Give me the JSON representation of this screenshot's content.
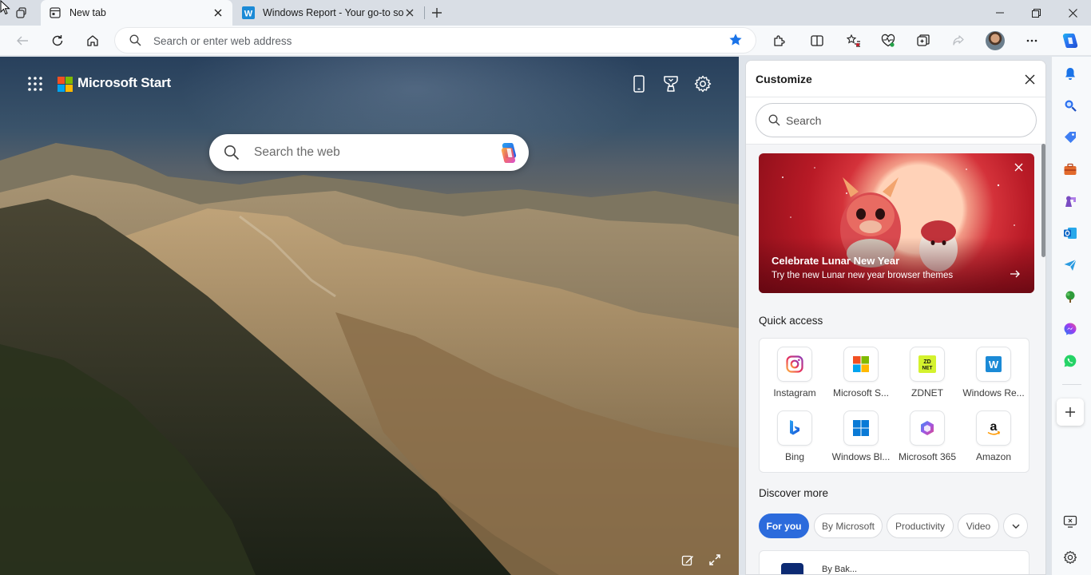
{
  "tabs": [
    {
      "title": "New tab",
      "active": true,
      "icon": "newtab-page-icon"
    },
    {
      "title": "Windows Report - Your go-to source",
      "active": false,
      "icon": "windows-report-favicon"
    }
  ],
  "address_bar": {
    "placeholder": "Search or enter web address"
  },
  "newtab": {
    "brand": "Microsoft Start",
    "search_placeholder": "Search the web"
  },
  "customize": {
    "title": "Customize",
    "search_placeholder": "Search",
    "promo": {
      "heading": "Celebrate Lunar New Year",
      "subtext": "Try the new Lunar new year browser themes"
    },
    "quick_access_title": "Quick access",
    "quick_access": [
      {
        "label": "Instagram",
        "icon": "instagram-icon"
      },
      {
        "label": "Microsoft S...",
        "icon": "microsoft-store-icon"
      },
      {
        "label": "ZDNET",
        "icon": "zdnet-icon"
      },
      {
        "label": "Windows Re...",
        "icon": "windows-report-icon"
      },
      {
        "label": "Bing",
        "icon": "bing-icon"
      },
      {
        "label": "Windows Bl...",
        "icon": "windows-blog-icon"
      },
      {
        "label": "Microsoft 365",
        "icon": "microsoft-365-icon"
      },
      {
        "label": "Amazon",
        "icon": "amazon-icon"
      }
    ],
    "discover_title": "Discover more",
    "chips": [
      "For you",
      "By Microsoft",
      "Productivity",
      "Video"
    ],
    "feed_partial_name": "By Bak..."
  },
  "colors": {
    "accent": "#2c6bdc",
    "star": "#1a73e8",
    "promo_red": "#c41e2b",
    "ms_red": "#f25022",
    "ms_green": "#7fba00",
    "ms_blue": "#00a4ef",
    "ms_yellow": "#ffb900"
  }
}
